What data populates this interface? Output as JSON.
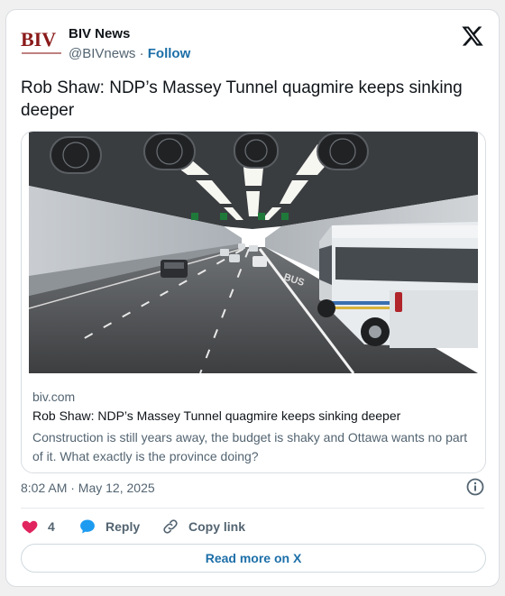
{
  "author": {
    "logo_text": "BIV",
    "name": "BIV News",
    "handle": "@BIVnews",
    "separator": "·",
    "follow_label": "Follow"
  },
  "post": {
    "text": "Rob Shaw: NDP’s Massey Tunnel quagmire keeps sinking deeper",
    "timestamp": "8:02 AM · May 12, 2025"
  },
  "link_card": {
    "domain": "biv.com",
    "title": "Rob Shaw: NDP’s Massey Tunnel quagmire keeps sinking deeper",
    "description": "Construction is still years away, the budget is shaky and Ottawa wants no part of it. What exactly is the province doing?",
    "image": "tunnel-rendering-with-bus-and-traffic"
  },
  "actions": {
    "like_count": "4",
    "reply_label": "Reply",
    "copy_label": "Copy link"
  },
  "read_more_label": "Read more on X",
  "icons": [
    "x-logo-icon",
    "info-icon",
    "heart-icon",
    "reply-bubble-icon",
    "link-icon"
  ],
  "colors": {
    "brand_logo": "#8b1a1a",
    "link_blue": "#1d6fa8",
    "heart": "#e0245e",
    "reply_bubble": "#1d9bf0",
    "muted_text": "#536471"
  }
}
